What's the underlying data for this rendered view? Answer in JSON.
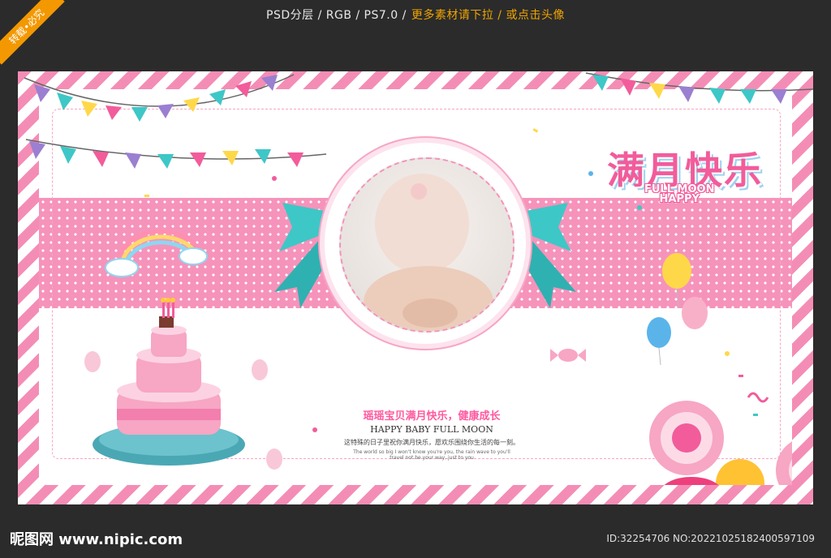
{
  "header": {
    "text": "PSD分层 / RGB / PS7.0 /",
    "highlight": "更多素材请下拉 / 或点击头像"
  },
  "corner_ribbon": "转载•必究",
  "poster": {
    "title_cn": "满月快乐",
    "title_en_line1": "FULL MOON",
    "title_en_line2": "HAPPY",
    "slogan_cn": "瑶瑶宝贝满月快乐，健康成长",
    "slogan_en": "HAPPY BABY FULL MOON",
    "desc_cn": "这特殊的日子里祝你满月快乐，愿欢乐围绕你生活的每一刻。",
    "desc_en_line1": "The world so big I won't know you're you, the rain wave to you'll",
    "desc_en_line2": "travel not be your way, just to you",
    "colors": {
      "stripe_pink": "#f48db5",
      "band_pink": "#f693bb",
      "ribbon_teal": "#3ec7c7",
      "title_pink": "#f25c9a"
    }
  },
  "footer": {
    "logo": "昵图网 www.nipic.com",
    "id_text": "ID:32254706 NO:20221025182400597109"
  }
}
